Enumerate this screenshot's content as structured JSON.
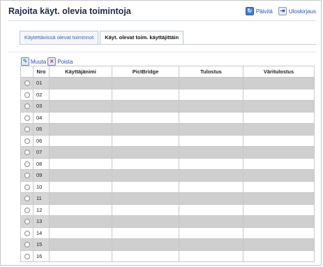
{
  "page": {
    "title": "Rajoita käyt. olevia toimintoja",
    "actions": {
      "refresh_label": "Päivitä",
      "logout_label": "Uloskirjaus"
    }
  },
  "tabs": [
    {
      "label": "Käytettävissä olevat toiminnot",
      "active": false
    },
    {
      "label": "Käyt. olevat toim. käyttäjittäin",
      "active": true
    }
  ],
  "toolbar": {
    "edit_label": "Muuta",
    "delete_label": "Poista"
  },
  "table": {
    "columns": [
      "",
      "Nro",
      "Käyttäjänimi",
      "PictBridge",
      "Tulostus",
      "Väritulostus"
    ],
    "rows": [
      {
        "nro": "01",
        "username": "",
        "pictbridge": "",
        "print": "",
        "color_print": ""
      },
      {
        "nro": "02",
        "username": "",
        "pictbridge": "",
        "print": "",
        "color_print": ""
      },
      {
        "nro": "03",
        "username": "",
        "pictbridge": "",
        "print": "",
        "color_print": ""
      },
      {
        "nro": "04",
        "username": "",
        "pictbridge": "",
        "print": "",
        "color_print": ""
      },
      {
        "nro": "05",
        "username": "",
        "pictbridge": "",
        "print": "",
        "color_print": ""
      },
      {
        "nro": "06",
        "username": "",
        "pictbridge": "",
        "print": "",
        "color_print": ""
      },
      {
        "nro": "07",
        "username": "",
        "pictbridge": "",
        "print": "",
        "color_print": ""
      },
      {
        "nro": "08",
        "username": "",
        "pictbridge": "",
        "print": "",
        "color_print": ""
      },
      {
        "nro": "09",
        "username": "",
        "pictbridge": "",
        "print": "",
        "color_print": ""
      },
      {
        "nro": "10",
        "username": "",
        "pictbridge": "",
        "print": "",
        "color_print": ""
      },
      {
        "nro": "11",
        "username": "",
        "pictbridge": "",
        "print": "",
        "color_print": ""
      },
      {
        "nro": "12",
        "username": "",
        "pictbridge": "",
        "print": "",
        "color_print": ""
      },
      {
        "nro": "13",
        "username": "",
        "pictbridge": "",
        "print": "",
        "color_print": ""
      },
      {
        "nro": "14",
        "username": "",
        "pictbridge": "",
        "print": "",
        "color_print": ""
      },
      {
        "nro": "15",
        "username": "",
        "pictbridge": "",
        "print": "",
        "color_print": ""
      },
      {
        "nro": "16",
        "username": "",
        "pictbridge": "",
        "print": "",
        "color_print": ""
      }
    ]
  },
  "colors": {
    "title": "#1c2a48",
    "link": "#2a55a8",
    "row_shaded": "#cfcfcf",
    "row_plain": "#ffffff",
    "grid_border": "#c8c8c8"
  }
}
